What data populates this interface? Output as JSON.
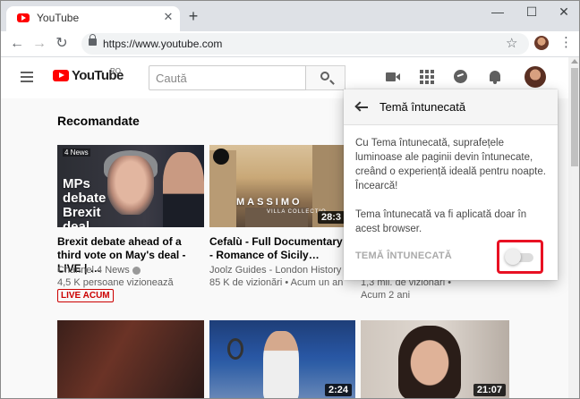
{
  "browser": {
    "tab_title": "YouTube",
    "new_tab_symbol": "+",
    "tab_close_symbol": "✕",
    "url": "https://www.youtube.com",
    "window_controls": [
      "—",
      "☐",
      "✕"
    ]
  },
  "header": {
    "logo_text": "YouTube",
    "country": "RO",
    "search_placeholder": "Caută"
  },
  "section_title": "Recomandate",
  "videos": [
    {
      "title": "Brexit debate ahead of a third vote on May's deal - LIVE | …",
      "channel": "Channel 4 News",
      "meta": "4,5 K persoane vizionează",
      "badge": "LIVE ACUM",
      "thumb_text": "MPs debate Brexit deal",
      "thumb_tag": "4 News"
    },
    {
      "title": "Cefalù - Full Documentary - Romance of Sicily…",
      "channel": "Joolz Guides - London History …",
      "meta": "85 K de vizionări • Acum un an",
      "duration": "28:3",
      "thumb_brand": "MASSIMO",
      "thumb_brand_sub": "VILLA COLLECTIO"
    },
    {
      "meta1": "1,3 mil. de vizionări •",
      "meta2": "Acum 2 ani"
    },
    {
      "duration": ""
    },
    {
      "duration": "2:24"
    },
    {
      "duration": "21:07"
    }
  ],
  "popup": {
    "title": "Temă întunecată",
    "description": "Cu Tema întunecată, suprafețele luminoase ale paginii devin întunecate, creând o experiență ideală pentru noapte. Încearcă!",
    "note": "Tema întunecată va fi aplicată doar în acest browser.",
    "toggle_label": "TEMĂ ÎNTUNECATĂ",
    "toggle_on": false
  },
  "colors": {
    "brand_red": "#ff0000",
    "highlight": "#e81123"
  }
}
